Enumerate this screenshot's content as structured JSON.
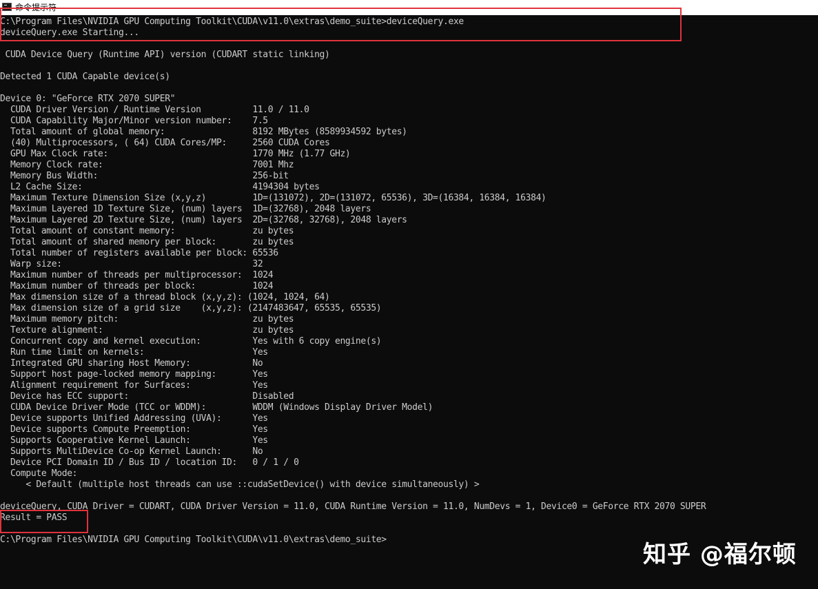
{
  "window": {
    "title": "命令提示符",
    "icon": "console-icon"
  },
  "console": {
    "lines": [
      "C:\\Program Files\\NVIDIA GPU Computing Toolkit\\CUDA\\v11.0\\extras\\demo_suite>deviceQuery.exe",
      "deviceQuery.exe Starting...",
      "",
      " CUDA Device Query (Runtime API) version (CUDART static linking)",
      "",
      "Detected 1 CUDA Capable device(s)",
      "",
      "Device 0: \"GeForce RTX 2070 SUPER\"",
      "  CUDA Driver Version / Runtime Version          11.0 / 11.0",
      "  CUDA Capability Major/Minor version number:    7.5",
      "  Total amount of global memory:                 8192 MBytes (8589934592 bytes)",
      "  (40) Multiprocessors, ( 64) CUDA Cores/MP:     2560 CUDA Cores",
      "  GPU Max Clock rate:                            1770 MHz (1.77 GHz)",
      "  Memory Clock rate:                             7001 Mhz",
      "  Memory Bus Width:                              256-bit",
      "  L2 Cache Size:                                 4194304 bytes",
      "  Maximum Texture Dimension Size (x,y,z)         1D=(131072), 2D=(131072, 65536), 3D=(16384, 16384, 16384)",
      "  Maximum Layered 1D Texture Size, (num) layers  1D=(32768), 2048 layers",
      "  Maximum Layered 2D Texture Size, (num) layers  2D=(32768, 32768), 2048 layers",
      "  Total amount of constant memory:               zu bytes",
      "  Total amount of shared memory per block:       zu bytes",
      "  Total number of registers available per block: 65536",
      "  Warp size:                                     32",
      "  Maximum number of threads per multiprocessor:  1024",
      "  Maximum number of threads per block:           1024",
      "  Max dimension size of a thread block (x,y,z): (1024, 1024, 64)",
      "  Max dimension size of a grid size    (x,y,z): (2147483647, 65535, 65535)",
      "  Maximum memory pitch:                          zu bytes",
      "  Texture alignment:                             zu bytes",
      "  Concurrent copy and kernel execution:          Yes with 6 copy engine(s)",
      "  Run time limit on kernels:                     Yes",
      "  Integrated GPU sharing Host Memory:            No",
      "  Support host page-locked memory mapping:       Yes",
      "  Alignment requirement for Surfaces:            Yes",
      "  Device has ECC support:                        Disabled",
      "  CUDA Device Driver Mode (TCC or WDDM):         WDDM (Windows Display Driver Model)",
      "  Device supports Unified Addressing (UVA):      Yes",
      "  Device supports Compute Preemption:            Yes",
      "  Supports Cooperative Kernel Launch:            Yes",
      "  Supports MultiDevice Co-op Kernel Launch:      No",
      "  Device PCI Domain ID / Bus ID / location ID:   0 / 1 / 0",
      "  Compute Mode:",
      "     < Default (multiple host threads can use ::cudaSetDevice() with device simultaneously) >",
      "",
      "deviceQuery, CUDA Driver = CUDART, CUDA Driver Version = 11.0, CUDA Runtime Version = 11.0, NumDevs = 1, Device0 = GeForce RTX 2070 SUPER",
      "Result = PASS",
      "",
      "C:\\Program Files\\NVIDIA GPU Computing Toolkit\\CUDA\\v11.0\\extras\\demo_suite>"
    ]
  },
  "watermark": {
    "text": "知乎 @福尔顿"
  },
  "colors": {
    "background": "#0c0c0c",
    "text": "#cccccc",
    "highlight": "#e0333c"
  }
}
